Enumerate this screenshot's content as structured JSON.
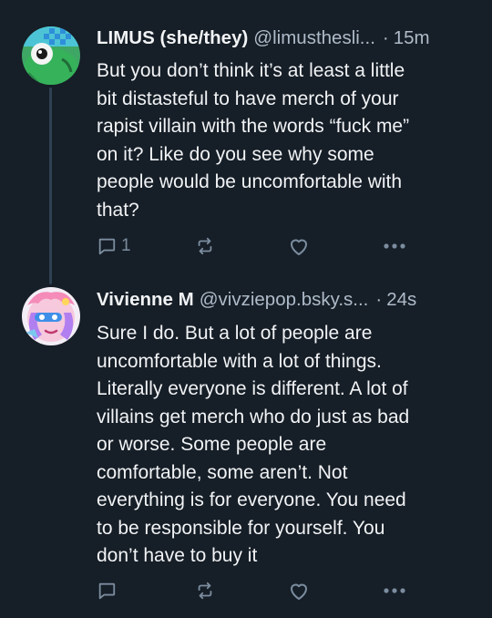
{
  "posts": [
    {
      "display_name": "LIMUS (she/they)",
      "handle": "@limusthesli...",
      "separator": "·",
      "time": "15m",
      "text": "But you don’t think it’s at least a little\nbit distasteful to have merch of your\nrapist villain with the words “fuck me”\non it? Like do you see why some\npeople would be uncomfortable with\nthat?",
      "reply_count": "1",
      "avatar_icon": "green-creature-avatar"
    },
    {
      "display_name": "Vivienne M",
      "handle": "@vivziepop.bsky.s...",
      "separator": "·",
      "time": "24s",
      "text": "Sure I do. But a lot of people are\nuncomfortable with a lot of things.\nLiterally everyone is different. A lot of\nvillains get merch who do just as bad\nor worse. Some people are\ncomfortable, some aren’t. Not\neverything is for everyone. You need\nto be responsible for yourself. You\ndon’t have to buy it",
      "reply_count": "",
      "avatar_icon": "pink-cartoon-avatar"
    }
  ],
  "icons": {
    "reply": "reply-icon",
    "repost": "repost-icon",
    "like": "like-icon",
    "more": "more-options-icon"
  },
  "colors": {
    "background": "#161e27",
    "text": "#f1f3f5",
    "muted": "#aebbc9",
    "icon": "#7b8d9f",
    "thread_line": "#2e4153"
  }
}
